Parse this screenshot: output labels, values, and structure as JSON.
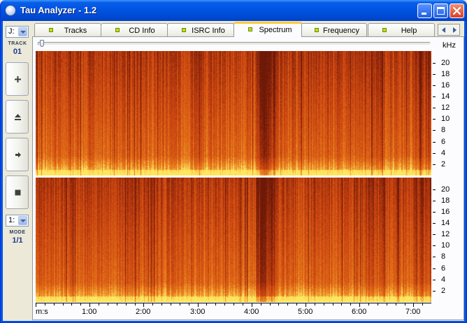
{
  "window": {
    "title": "Tau Analyzer - 1.2"
  },
  "left_panel": {
    "drive_select": {
      "value": "J:"
    },
    "track_label": "TRACK",
    "track_value": "01",
    "mode_select": {
      "value": "1:"
    },
    "mode_label": "MODE",
    "mode_value": "1/1",
    "buttons": [
      {
        "name": "volume-up-button",
        "icon": "plus-icon"
      },
      {
        "name": "eject-button",
        "icon": "eject-icon"
      },
      {
        "name": "play-button",
        "icon": "play-icon"
      },
      {
        "name": "stop-button",
        "icon": "stop-icon"
      }
    ]
  },
  "tabs": [
    {
      "label": "Tracks",
      "active": false
    },
    {
      "label": "CD Info",
      "active": false
    },
    {
      "label": "ISRC Info",
      "active": false
    },
    {
      "label": "Spectrum",
      "active": true
    },
    {
      "label": "Frequency",
      "active": false
    },
    {
      "label": "Help",
      "active": false
    }
  ],
  "spectrum": {
    "freq_unit": "kHz",
    "freq_ticks": [
      "20",
      "18",
      "16",
      "14",
      "12",
      "10",
      "8",
      "6",
      "4",
      "2"
    ],
    "time_axis_label": "m:s",
    "time_ticks": [
      "1:00",
      "2:00",
      "3:00",
      "4:00",
      "5:00",
      "6:00",
      "7:00"
    ],
    "channels": 2,
    "colors": {
      "high": "#f6d84a",
      "mid": "#e8781a",
      "low": "#c84a10",
      "dark": "#7a2408"
    }
  }
}
